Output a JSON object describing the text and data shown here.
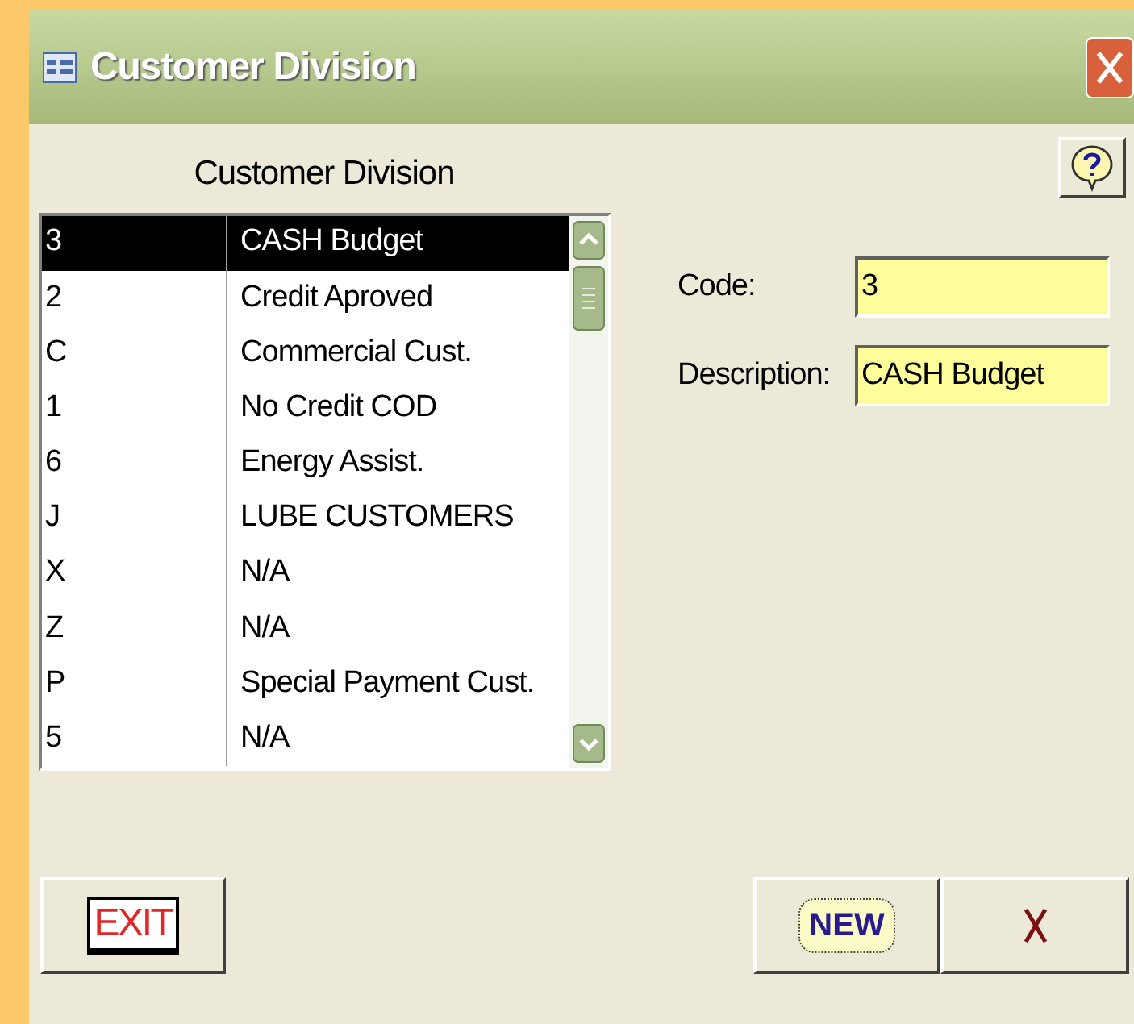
{
  "window": {
    "title": "Customer Division"
  },
  "list": {
    "heading": "Customer Division",
    "rows": [
      {
        "code": "3",
        "description": "CASH Budget",
        "selected": true
      },
      {
        "code": "2",
        "description": "Credit Aproved",
        "selected": false
      },
      {
        "code": "C",
        "description": "Commercial Cust.",
        "selected": false
      },
      {
        "code": "1",
        "description": "No Credit COD",
        "selected": false
      },
      {
        "code": "6",
        "description": "Energy Assist.",
        "selected": false
      },
      {
        "code": "J",
        "description": "LUBE CUSTOMERS",
        "selected": false
      },
      {
        "code": "X",
        "description": "N/A",
        "selected": false
      },
      {
        "code": "Z",
        "description": "N/A",
        "selected": false
      },
      {
        "code": "P",
        "description": "Special Payment Cust.",
        "selected": false
      },
      {
        "code": "5",
        "description": "N/A",
        "selected": false
      }
    ]
  },
  "fields": [
    {
      "label": "Code:",
      "value": "3"
    },
    {
      "label": "Description:",
      "value": "CASH Budget"
    }
  ],
  "buttons": {
    "exit": "EXIT",
    "new": "NEW"
  }
}
